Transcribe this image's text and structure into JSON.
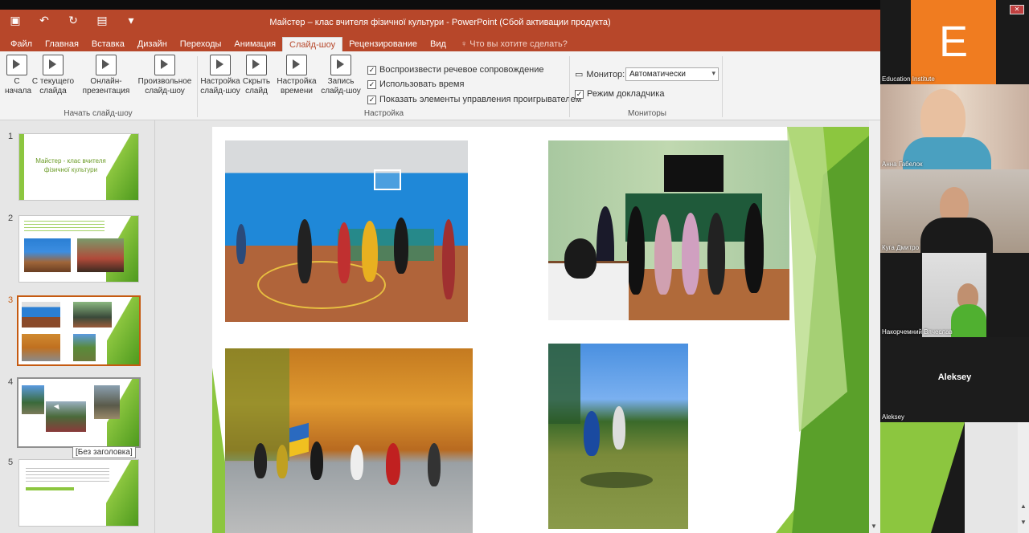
{
  "window": {
    "title": "Майстер – клас вчителя фізичної культури - PowerPoint (Сбой активации продукта)"
  },
  "qat": [
    "save-icon",
    "undo-icon",
    "redo-icon",
    "presenter-icon",
    "customize-icon"
  ],
  "tabs": [
    "Файл",
    "Главная",
    "Вставка",
    "Дизайн",
    "Переходы",
    "Анимация",
    "Слайд-шоу",
    "Рецензирование",
    "Вид"
  ],
  "active_tab": "Слайд-шоу",
  "tell_me": "Что вы хотите сделать?",
  "ribbon": {
    "from_start": "С\nначала",
    "from_current": "С текущего\nслайда",
    "online": "Онлайн-\nпрезентация",
    "custom": "Произвольное\nслайд-шоу",
    "setup": "Настройка\nслайд-шоу",
    "hide": "Скрыть\nслайд",
    "rehearse": "Настройка\nвремени",
    "record": "Запись\nслайд-шоу",
    "group_start": "Начать слайд-шоу",
    "group_setup": "Настройка",
    "group_monitors": "Мониторы",
    "chk_narration": "Воспроизвести речевое сопровождение",
    "chk_timings": "Использовать время",
    "chk_controls": "Показать элементы управления проигрывателем",
    "monitor_label": "Монитор:",
    "monitor_value": "Автоматически",
    "presenter_view": "Режим докладчика"
  },
  "slides": [
    {
      "num": "1",
      "title": "Майстер - клас вчителя фізичної культури"
    },
    {
      "num": "2"
    },
    {
      "num": "3"
    },
    {
      "num": "4"
    },
    {
      "num": "5"
    }
  ],
  "tooltip": "[Без заголовка]",
  "participants": [
    {
      "name": "Education Institute",
      "initial": "E"
    },
    {
      "name": "Анна Габелок"
    },
    {
      "name": "Куга Дмитро"
    },
    {
      "name": "Накорчемний Вячеслав"
    },
    {
      "name": "Aleksey",
      "label": "Aleksey"
    }
  ],
  "colors": {
    "accent": "#b7472a",
    "green": "#8cc63f",
    "selected": "#c55a11",
    "zoom_orange": "#f07c20"
  }
}
